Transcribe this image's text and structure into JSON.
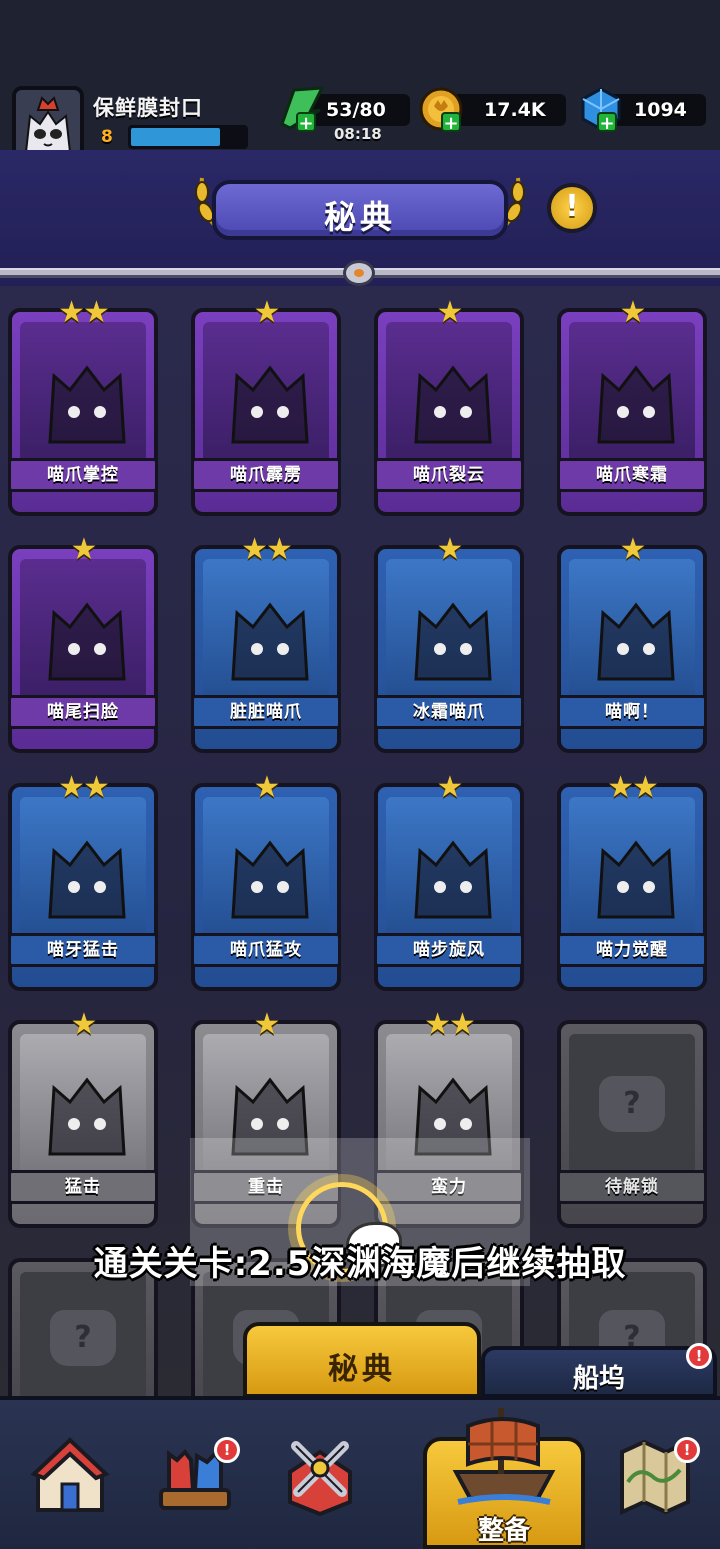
{
  "player": {
    "name": "保鲜膜封口",
    "level": "8",
    "xp_fraction": 0.78
  },
  "resources": {
    "energy": "53/80",
    "energy_timer": "08:18",
    "coins": "17.4K",
    "gems": "1094"
  },
  "page": {
    "title": "秘典",
    "info_symbol": "!"
  },
  "cards": [
    {
      "label": "喵爪掌控",
      "stars": 2,
      "tier": "purple"
    },
    {
      "label": "喵爪霹雳",
      "stars": 1,
      "tier": "purple"
    },
    {
      "label": "喵爪裂云",
      "stars": 1,
      "tier": "purple"
    },
    {
      "label": "喵爪寒霜",
      "stars": 1,
      "tier": "purple"
    },
    {
      "label": "喵尾扫脸",
      "stars": 1,
      "tier": "purple"
    },
    {
      "label": "脏脏喵爪",
      "stars": 2,
      "tier": "blue"
    },
    {
      "label": "冰霜喵爪",
      "stars": 1,
      "tier": "blue"
    },
    {
      "label": "喵啊！",
      "stars": 1,
      "tier": "blue"
    },
    {
      "label": "喵牙猛击",
      "stars": 2,
      "tier": "blue"
    },
    {
      "label": "喵爪猛攻",
      "stars": 1,
      "tier": "blue"
    },
    {
      "label": "喵步旋风",
      "stars": 1,
      "tier": "blue"
    },
    {
      "label": "喵力觉醒",
      "stars": 2,
      "tier": "blue"
    },
    {
      "label": "猛击",
      "stars": 1,
      "tier": "gray"
    },
    {
      "label": "重击",
      "stars": 1,
      "tier": "gray"
    },
    {
      "label": "蛮力",
      "stars": 2,
      "tier": "gray"
    },
    {
      "label": "待解锁",
      "stars": 0,
      "tier": "locked"
    }
  ],
  "locked_symbol": "?",
  "tutorial": {
    "hint": "通关关卡:2.5深渊海魔后继续抽取"
  },
  "subtabs": {
    "active": "秘典",
    "other": "船坞",
    "other_badge": "!"
  },
  "nav": {
    "active_label": "整备",
    "badge": "!"
  },
  "colors": {
    "purple_card": "#7a3fbf",
    "blue_card": "#2f61b2",
    "gray_card": "#8b8b90",
    "gold_accent": "#f7c93c",
    "star": "#f0c93a"
  }
}
